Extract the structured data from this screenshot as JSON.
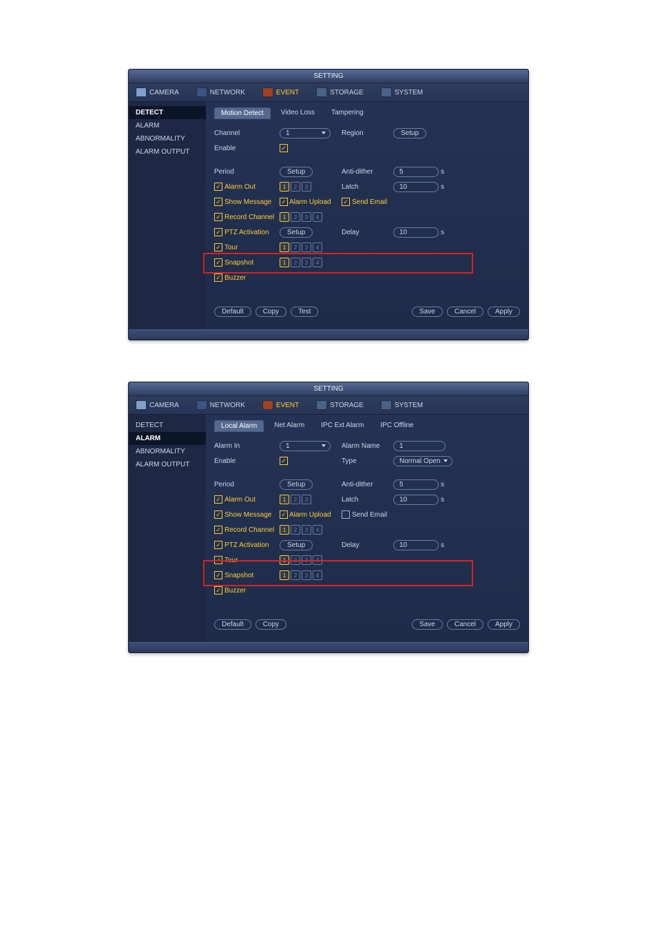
{
  "common": {
    "title": "SETTING",
    "topnav": {
      "camera": "CAMERA",
      "network": "NETWORK",
      "event": "EVENT",
      "storage": "STORAGE",
      "system": "SYSTEM"
    },
    "side": {
      "detect": "DETECT",
      "alarm": "ALARM",
      "abnormality": "ABNORMALITY",
      "alarm_output": "ALARM OUTPUT"
    },
    "buttons": {
      "default": "Default",
      "copy": "Copy",
      "test": "Test",
      "save": "Save",
      "cancel": "Cancel",
      "apply": "Apply",
      "setup": "Setup"
    },
    "labels": {
      "channel": "Channel",
      "region": "Region",
      "enable": "Enable",
      "period": "Period",
      "anti_dither": "Anti-dither",
      "alarm_out": "Alarm Out",
      "latch": "Latch",
      "show_message": "Show Message",
      "alarm_upload": "Alarm Upload",
      "send_email": "Send Email",
      "record_channel": "Record Channel",
      "ptz_activation": "PTZ Activation",
      "delay": "Delay",
      "tour": "Tour",
      "snapshot": "Snapshot",
      "buzzer": "Buzzer",
      "s": "s",
      "alarm_in": "Alarm In",
      "alarm_name": "Alarm Name",
      "type": "Type"
    },
    "chan1234": [
      "1",
      "2",
      "3",
      "4"
    ],
    "chan123": [
      "1",
      "2",
      "3"
    ]
  },
  "win1": {
    "subtabs": {
      "motion": "Motion Detect",
      "video_loss": "Video Loss",
      "tampering": "Tampering"
    },
    "channel_value": "1",
    "anti_dither_value": "5",
    "latch_value": "10",
    "delay_value": "10"
  },
  "win2": {
    "subtabs": {
      "local": "Local Alarm",
      "net": "Net Alarm",
      "ipc_ext": "IPC Ext Alarm",
      "ipc_offline": "IPC Offline"
    },
    "alarm_in_value": "1",
    "alarm_name_value": "1",
    "type_value": "Normal Open",
    "anti_dither_value": "5",
    "latch_value": "10",
    "delay_value": "10"
  }
}
